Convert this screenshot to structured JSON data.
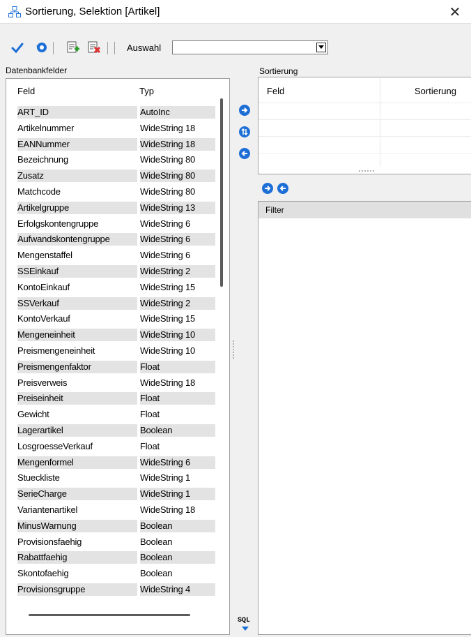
{
  "window": {
    "title": "Sortierung, Selektion [Artikel]"
  },
  "toolbar": {
    "ok_icon": "checkmark-icon",
    "undo_icon": "undo-icon",
    "add_icon": "add-record-icon",
    "delete_icon": "delete-record-icon",
    "auswahl_label": "Auswahl",
    "auswahl_value": ""
  },
  "datenbankfelder": {
    "label": "Datenbankfelder",
    "header_feld": "Feld",
    "header_typ": "Typ",
    "rows": [
      {
        "feld": "ART_ID",
        "typ": "AutoInc"
      },
      {
        "feld": "Artikelnummer",
        "typ": "WideString  18"
      },
      {
        "feld": "EANNummer",
        "typ": "WideString  18"
      },
      {
        "feld": "Bezeichnung",
        "typ": "WideString  80"
      },
      {
        "feld": "Zusatz",
        "typ": "WideString  80"
      },
      {
        "feld": "Matchcode",
        "typ": "WideString  80"
      },
      {
        "feld": "Artikelgruppe",
        "typ": "WideString  13"
      },
      {
        "feld": "Erfolgskontengruppe",
        "typ": "WideString   6"
      },
      {
        "feld": "Aufwandskontengruppe",
        "typ": "WideString   6"
      },
      {
        "feld": "Mengenstaffel",
        "typ": "WideString   6"
      },
      {
        "feld": "SSEinkauf",
        "typ": "WideString   2"
      },
      {
        "feld": "KontoEinkauf",
        "typ": "WideString  15"
      },
      {
        "feld": "SSVerkauf",
        "typ": "WideString   2"
      },
      {
        "feld": "KontoVerkauf",
        "typ": "WideString  15"
      },
      {
        "feld": "Mengeneinheit",
        "typ": "WideString  10"
      },
      {
        "feld": "Preismengeneinheit",
        "typ": "WideString  10"
      },
      {
        "feld": "Preismengenfaktor",
        "typ": "Float"
      },
      {
        "feld": "Preisverweis",
        "typ": "WideString  18"
      },
      {
        "feld": "Preiseinheit",
        "typ": "Float"
      },
      {
        "feld": "Gewicht",
        "typ": "Float"
      },
      {
        "feld": "Lagerartikel",
        "typ": "Boolean"
      },
      {
        "feld": "LosgroesseVerkauf",
        "typ": "Float"
      },
      {
        "feld": "Mengenformel",
        "typ": "WideString   6"
      },
      {
        "feld": "Stueckliste",
        "typ": "WideString   1"
      },
      {
        "feld": "SerieCharge",
        "typ": "WideString   1"
      },
      {
        "feld": "Variantenartikel",
        "typ": "WideString  18"
      },
      {
        "feld": "MinusWarnung",
        "typ": "Boolean"
      },
      {
        "feld": "Provisionsfaehig",
        "typ": "Boolean"
      },
      {
        "feld": "Rabattfaehig",
        "typ": "Boolean"
      },
      {
        "feld": "Skontofaehig",
        "typ": "Boolean"
      },
      {
        "feld": "Provisionsgruppe",
        "typ": "WideString   4"
      }
    ]
  },
  "sortierung": {
    "label": "Sortierung",
    "header_feld": "Feld",
    "header_sortierung": "Sortierung"
  },
  "filter": {
    "header": "Filter"
  },
  "sql": {
    "label": "SQL"
  },
  "colors": {
    "accent": "#1d6fd6",
    "row_alt": "#e3e3e3",
    "background": "#f0f0f0"
  }
}
